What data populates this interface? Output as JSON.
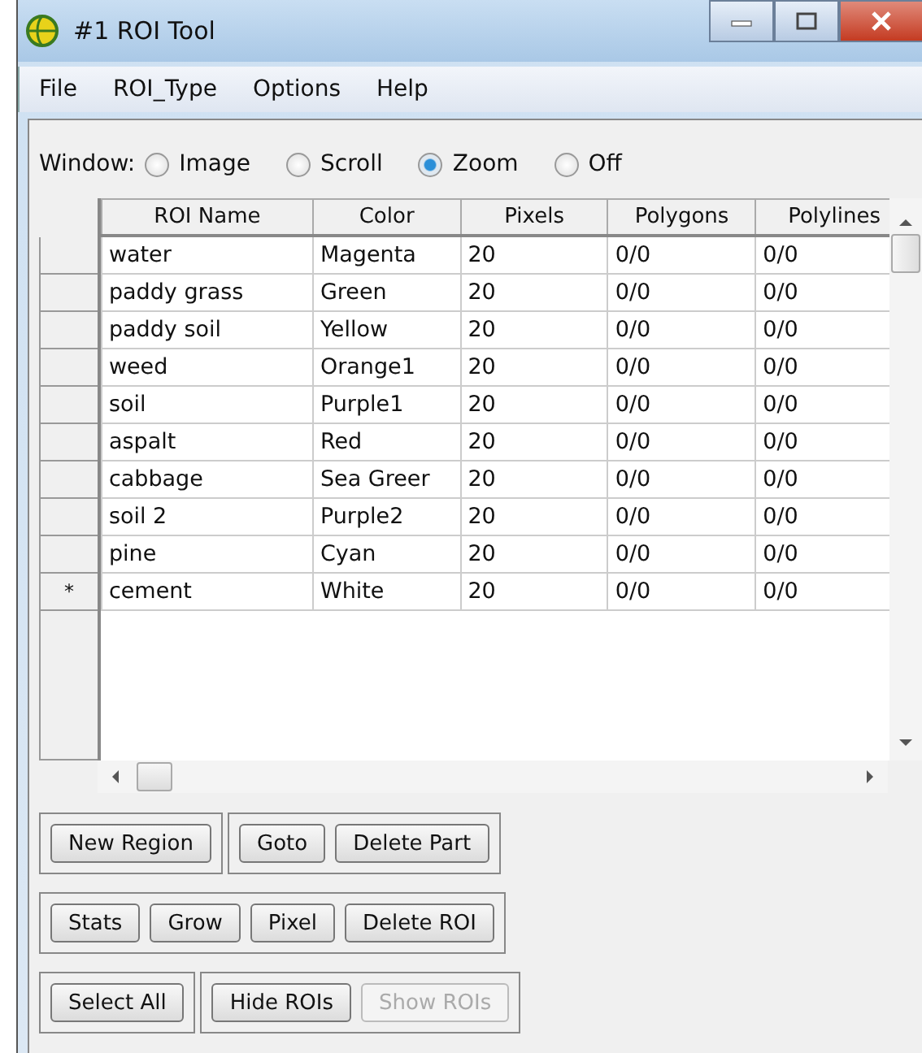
{
  "window": {
    "title": "#1 ROI Tool"
  },
  "menu": [
    "File",
    "ROI_Type",
    "Options",
    "Help"
  ],
  "window_mode": {
    "label": "Window:",
    "options": [
      {
        "label": "Image",
        "selected": false
      },
      {
        "label": "Scroll",
        "selected": false
      },
      {
        "label": "Zoom",
        "selected": true
      },
      {
        "label": "Off",
        "selected": false
      }
    ]
  },
  "table": {
    "columns": [
      "ROI Name",
      "Color",
      "Pixels",
      "Polygons",
      "Polylines"
    ],
    "rows": [
      {
        "cells": [
          "water",
          "Magenta",
          "20",
          "0/0",
          "0/0"
        ]
      },
      {
        "cells": [
          "paddy grass",
          "Green",
          "20",
          "0/0",
          "0/0"
        ]
      },
      {
        "cells": [
          "paddy soil",
          "Yellow",
          "20",
          "0/0",
          "0/0"
        ]
      },
      {
        "cells": [
          "weed",
          "Orange1",
          "20",
          "0/0",
          "0/0"
        ]
      },
      {
        "cells": [
          "soil",
          "Purple1",
          "20",
          "0/0",
          "0/0"
        ]
      },
      {
        "cells": [
          "aspalt",
          "Red",
          "20",
          "0/0",
          "0/0"
        ]
      },
      {
        "cells": [
          "cabbage",
          "Sea Greer",
          "20",
          "0/0",
          "0/0"
        ]
      },
      {
        "cells": [
          "soil 2",
          "Purple2",
          "20",
          "0/0",
          "0/0"
        ]
      },
      {
        "cells": [
          "pine",
          "Cyan",
          "20",
          "0/0",
          "0/0"
        ]
      },
      {
        "marker": "*",
        "cells": [
          "cement",
          "White",
          "20",
          "0/0",
          "0/0"
        ]
      }
    ]
  },
  "button_rows": [
    [
      [
        {
          "label": "New Region",
          "disabled": false
        }
      ],
      [
        {
          "label": "Goto",
          "disabled": false
        },
        {
          "label": "Delete Part",
          "disabled": false
        }
      ]
    ],
    [
      [
        {
          "label": "Stats",
          "disabled": false
        },
        {
          "label": "Grow",
          "disabled": false
        },
        {
          "label": "Pixel",
          "disabled": false
        },
        {
          "label": "Delete ROI",
          "disabled": false
        }
      ]
    ],
    [
      [
        {
          "label": "Select All",
          "disabled": false
        }
      ],
      [
        {
          "label": "Hide ROIs",
          "disabled": false
        },
        {
          "label": "Show ROIs",
          "disabled": true
        }
      ]
    ]
  ]
}
